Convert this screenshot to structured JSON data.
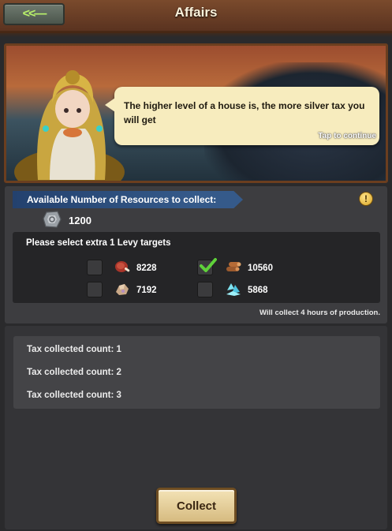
{
  "header": {
    "back_label": "<<—",
    "title": "Affairs"
  },
  "banner": {
    "dialog_text": "The higher level of a house is, the more silver tax you will get",
    "tap_hint": "Tap to continue"
  },
  "resources": {
    "available_label": "Available Number of Resources to collect:",
    "info_icon": "info-icon",
    "silver_icon": "silver-coin-icon",
    "silver_amount": "1200",
    "levy_title": "Please select extra 1 Levy targets",
    "levy_options": [
      {
        "icon": "food-meat-icon",
        "value": "8228",
        "checked": false
      },
      {
        "icon": "wood-logs-icon",
        "value": "10560",
        "checked": true
      },
      {
        "icon": "stone-ore-icon",
        "value": "7192",
        "checked": false
      },
      {
        "icon": "crystal-gem-icon",
        "value": "5868",
        "checked": false
      }
    ],
    "will_collect": "Will collect 4 hours of production."
  },
  "tax": {
    "items": [
      "Tax collected count: 1",
      "Tax collected count: 2",
      "Tax collected count: 3"
    ]
  },
  "actions": {
    "collect_label": "Collect"
  },
  "colors": {
    "header_brown": "#5a3320",
    "speech_bg": "#f7ecbe",
    "panel": "#3d3d40",
    "check_green": "#5fd23a"
  }
}
